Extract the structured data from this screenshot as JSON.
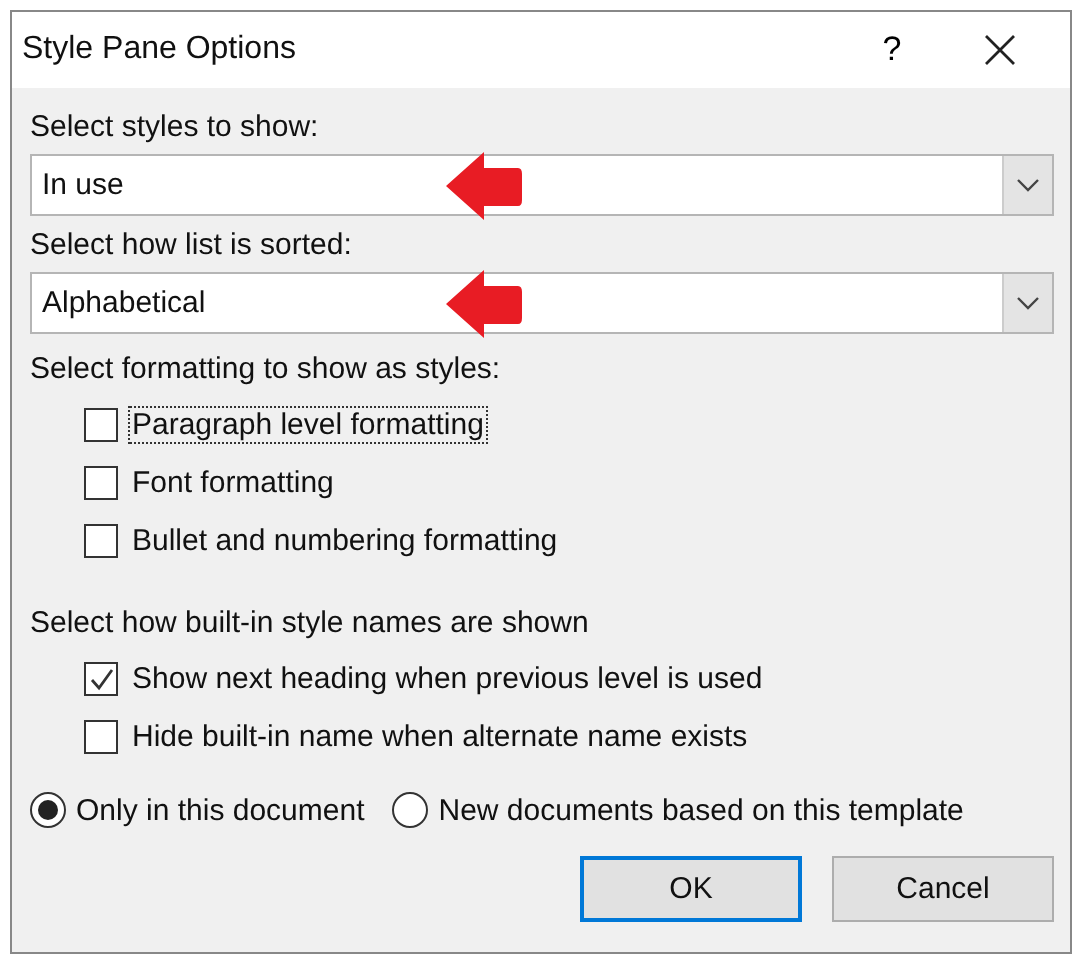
{
  "window": {
    "title": "Style Pane Options",
    "help": "?"
  },
  "dropdowns": [
    {
      "label": "Select styles to show:",
      "value": "In use",
      "marked": true
    },
    {
      "label": "Select how list is sorted:",
      "value": "Alphabetical",
      "marked": true
    }
  ],
  "formatting": {
    "label": "Select formatting to show as styles:",
    "options": [
      {
        "label": "Paragraph level formatting",
        "checked": false,
        "focused": true
      },
      {
        "label": "Font formatting",
        "checked": false,
        "focused": false
      },
      {
        "label": "Bullet and numbering formatting",
        "checked": false,
        "focused": false
      }
    ]
  },
  "names": {
    "label": "Select how built-in style names are shown",
    "options": [
      {
        "label": "Show next heading when previous level is used",
        "checked": true,
        "focused": false
      },
      {
        "label": "Hide built-in name when alternate name exists",
        "checked": false,
        "focused": false
      }
    ]
  },
  "scope": [
    {
      "label": "Only in this document",
      "selected": true
    },
    {
      "label": "New documents based on this template",
      "selected": false
    }
  ],
  "buttons": [
    {
      "label": "OK",
      "default": true
    },
    {
      "label": "Cancel",
      "default": false
    }
  ]
}
